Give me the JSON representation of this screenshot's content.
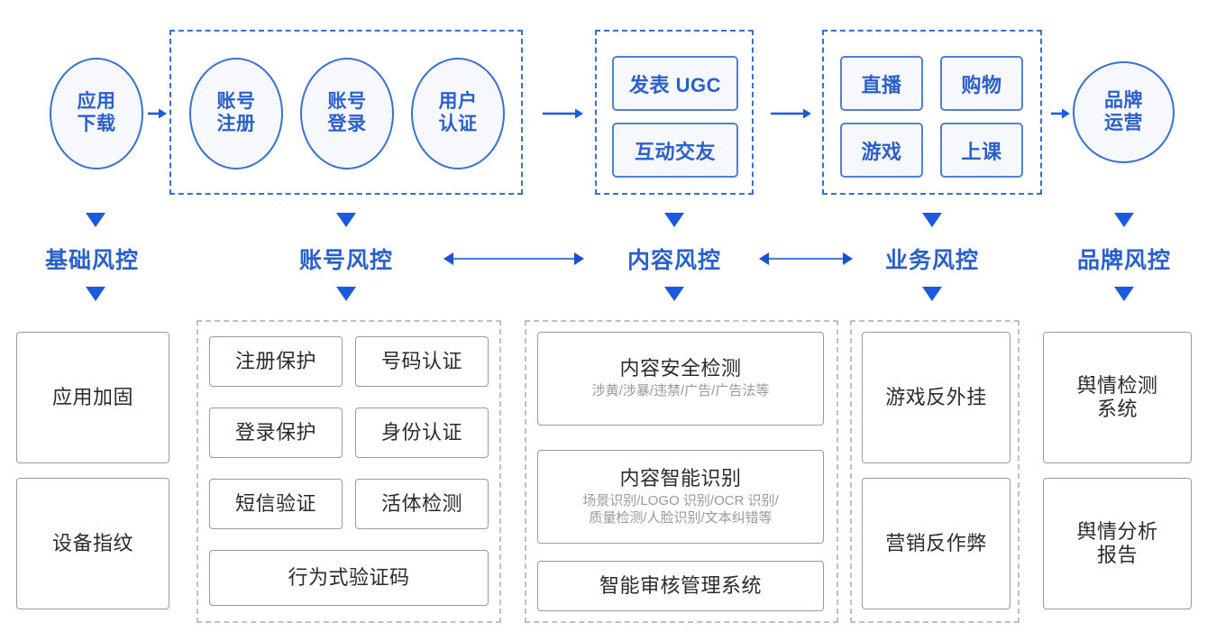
{
  "colors": {
    "blue_stroke": "#3a6fd8",
    "blue_text": "#2a5fd0",
    "blue_fill": "#f7f8fd",
    "arrow_blue": "#1a5ae0",
    "grey_stroke": "#9a9a9a",
    "grey_dash": "#c0c0c0",
    "dark_text": "#2b2b2b",
    "sub_text": "#9a9a9a"
  },
  "flow": {
    "stage1": {
      "circle": "应用\n下载",
      "line1": "应用",
      "line2": "下载"
    },
    "stage2_group": [
      {
        "line1": "账号",
        "line2": "注册"
      },
      {
        "line1": "账号",
        "line2": "登录"
      },
      {
        "line1": "用户",
        "line2": "认证"
      }
    ],
    "stage3_group": [
      {
        "label": "发表 UGC"
      },
      {
        "label": "互动交友"
      }
    ],
    "stage4_group": [
      {
        "label": "直播"
      },
      {
        "label": "购物"
      },
      {
        "label": "游戏"
      },
      {
        "label": "上课"
      }
    ],
    "stage5": {
      "line1": "品牌",
      "line2": "运营"
    }
  },
  "risk_labels": [
    {
      "label": "基础风控"
    },
    {
      "label": "账号风控"
    },
    {
      "label": "内容风控"
    },
    {
      "label": "业务风控"
    },
    {
      "label": "品牌风控"
    }
  ],
  "columns": {
    "basic": {
      "items": [
        {
          "title": "应用加固",
          "sub": ""
        },
        {
          "title": "设备指纹",
          "sub": ""
        }
      ]
    },
    "account": {
      "items": [
        {
          "title": "注册保护",
          "sub": ""
        },
        {
          "title": "号码认证",
          "sub": ""
        },
        {
          "title": "登录保护",
          "sub": ""
        },
        {
          "title": "身份认证",
          "sub": ""
        },
        {
          "title": "短信验证",
          "sub": ""
        },
        {
          "title": "活体检测",
          "sub": ""
        },
        {
          "title": "行为式验证码",
          "sub": ""
        }
      ]
    },
    "content": {
      "items": [
        {
          "title": "内容安全检测",
          "sub": "涉黄/涉暴/违禁/广告/广告法等"
        },
        {
          "title": "内容智能识别",
          "sub": "场景识别/LOGO 识别/OCR 识别/\n质量检测/人脸识别/文本纠错等"
        },
        {
          "title": "智能审核管理系统",
          "sub": ""
        }
      ],
      "sub2_line1": "场景识别/LOGO 识别/OCR 识别/",
      "sub2_line2": "质量检测/人脸识别/文本纠错等"
    },
    "business": {
      "items": [
        {
          "title": "游戏反外挂",
          "sub": ""
        },
        {
          "title": "营销反作弊",
          "sub": ""
        }
      ]
    },
    "brand": {
      "items": [
        {
          "line1": "舆情检测",
          "line2": "系统"
        },
        {
          "line1": "舆情分析",
          "line2": "报告"
        }
      ]
    }
  }
}
